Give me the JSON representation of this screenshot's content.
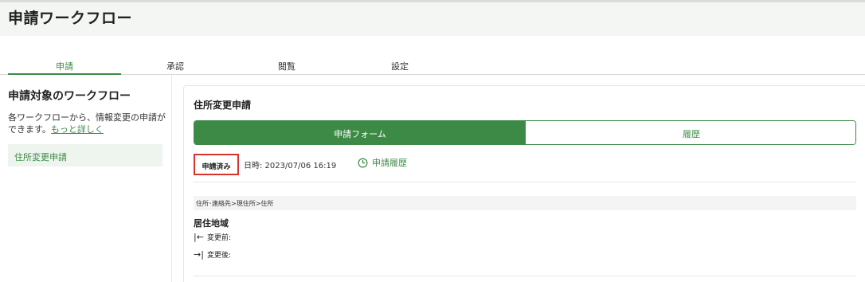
{
  "header": {
    "title": "申請ワークフロー"
  },
  "tabs": [
    {
      "label": "申請",
      "active": true
    },
    {
      "label": "承認",
      "active": false
    },
    {
      "label": "閲覧",
      "active": false
    },
    {
      "label": "設定",
      "active": false
    }
  ],
  "sidebar": {
    "heading": "申請対象のワークフロー",
    "description": "各ワークフローから、情報変更の申請ができます。",
    "more_link": "もっと詳しく",
    "items": [
      {
        "label": "住所変更申請",
        "selected": true
      }
    ]
  },
  "panel": {
    "title": "住所変更申請",
    "segments": {
      "form": "申請フォーム",
      "history": "履歴",
      "active": "form"
    },
    "status": {
      "badge": "申請済み",
      "datetime": "日時: 2023/07/06 16:19",
      "history_link": "申請履歴",
      "history_icon": "clock-icon"
    },
    "breadcrumb": "住所･連絡先>現住所>住所",
    "section_title": "居住地域",
    "fields": {
      "before_icon": "|←",
      "before_label": "変更前:",
      "after_icon": "→|",
      "after_label": "変更後:"
    }
  },
  "colors": {
    "accent": "#3c8a45",
    "highlight_border": "#d9342b",
    "header_bg": "#f4f6f4"
  }
}
